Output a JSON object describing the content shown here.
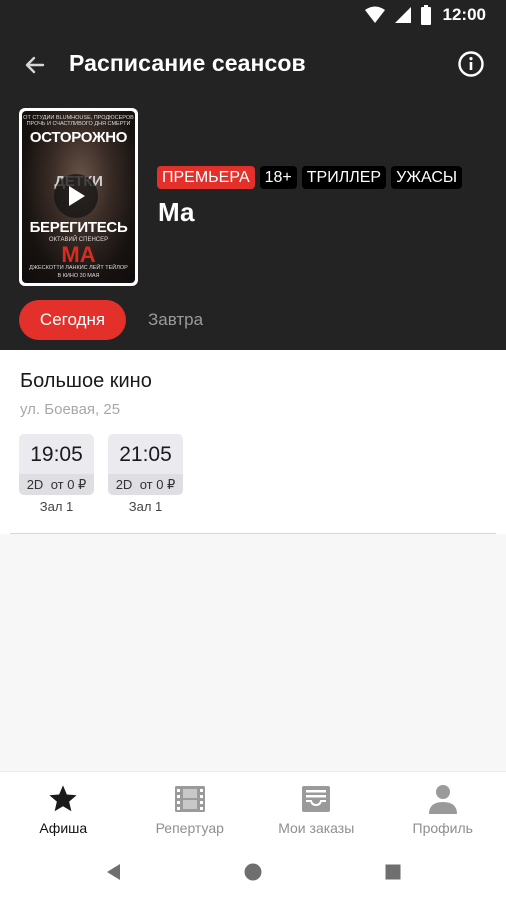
{
  "status_bar": {
    "time": "12:00"
  },
  "header": {
    "title": "Расписание сеансов"
  },
  "movie": {
    "title": "Ма",
    "tags": [
      "ПРЕМЬЕРА",
      "18+",
      "ТРИЛЛЕР",
      "УЖАСЫ"
    ],
    "poster": {
      "line1": "ОТ СТУДИИ BLUMHOUSE, ПРОДЮСЕРОВ",
      "line2": "ПРОЧЬ И СЧАСТЛИВОГО ДНЯ СМЕРТИ",
      "headline1": "ОСТОРОЖНО",
      "headline2": "ДЕТКИ",
      "headline3": "БЕРЕГИТЕСЬ",
      "actress": "ОКТАВИЙ СПЕНСЕР",
      "title": "МА",
      "credits": "ДЖЕСКОТТИ ЛАНКИС    ЛЕЙТ ТЕЙЛОР",
      "release": "В КИНО 30 МАЯ"
    }
  },
  "day_tabs": {
    "today": "Сегодня",
    "tomorrow": "Завтра"
  },
  "cinema": {
    "name": "Большое кино",
    "address": "ул. Боевая, 25",
    "sessions": [
      {
        "time": "19:05",
        "format": "2D",
        "price": "от 0 ₽",
        "hall": "Зал 1"
      },
      {
        "time": "21:05",
        "format": "2D",
        "price": "от 0 ₽",
        "hall": "Зал 1"
      }
    ]
  },
  "bottom_nav": [
    {
      "label": "Афиша",
      "icon": "star-icon",
      "active": true
    },
    {
      "label": "Репертуар",
      "icon": "film-icon",
      "active": false
    },
    {
      "label": "Мои заказы",
      "icon": "inbox-icon",
      "active": false
    },
    {
      "label": "Профиль",
      "icon": "person-icon",
      "active": false
    }
  ],
  "colors": {
    "accent": "#e3302a",
    "header_bg": "#232323",
    "tag_bg": "#000000"
  }
}
